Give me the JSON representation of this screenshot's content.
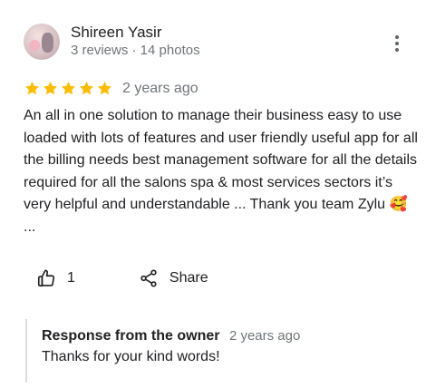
{
  "reviewer": {
    "name": "Shireen Yasir",
    "stats": "3 reviews · 14 photos"
  },
  "rating": {
    "stars": 5,
    "max": 5,
    "color": "#fbbc04",
    "date": "2 years ago"
  },
  "review": {
    "text": "An all in one solution  to manage their business easy to use loaded with lots of features and user friendly useful app for all the billing needs best management software for all the details required for all the salons spa & most services sectors it’s very helpful and understandable ... Thank you team Zylu 🥰 ..."
  },
  "actions": {
    "like_count": "1",
    "share_label": "Share",
    "like_icon": "thumbs-up-icon",
    "share_icon": "share-icon",
    "more_icon": "more-vert-icon"
  },
  "owner_response": {
    "title": "Response from the owner",
    "date": "2 years ago",
    "text": "Thanks for your kind words!"
  }
}
